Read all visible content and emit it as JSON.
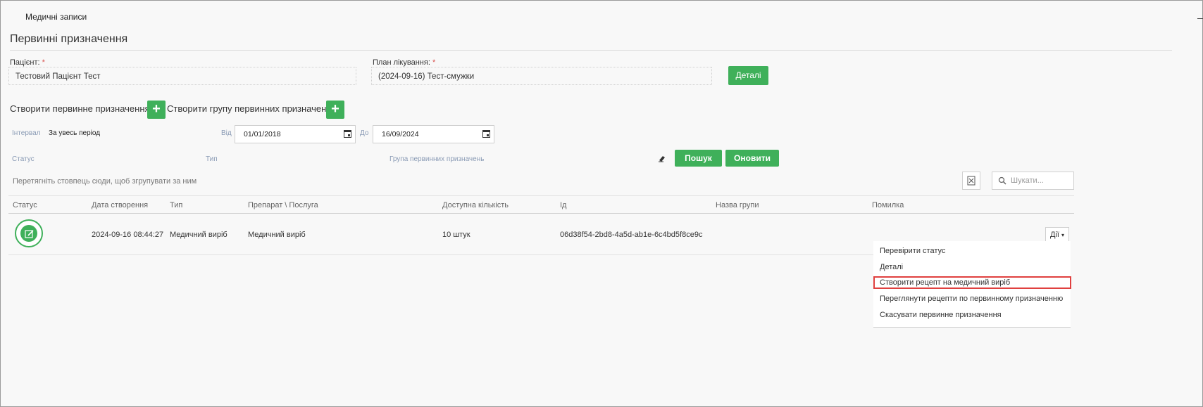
{
  "breadcrumb": "Медичні записи",
  "page_title": "Первинні призначення",
  "patient": {
    "label": "Пацієнт:",
    "required_mark": "*",
    "value": "Тестовий Пацієнт Тест"
  },
  "plan": {
    "label": "План лікування:",
    "required_mark": "*",
    "value": "(2024-09-16) Тест-смужки"
  },
  "details_button": "Деталі",
  "create": {
    "primary_label": "Створити первинне призначення",
    "group_label": "Створити групу первинних призначень",
    "plus_glyph": "+"
  },
  "filters": {
    "interval_label": "Інтервал",
    "interval_value": "За увесь період",
    "from_label": "Від",
    "from_value": "01/01/2018",
    "to_label": "До",
    "to_value": "16/09/2024",
    "status_label": "Статус",
    "type_label": "Тип",
    "group_label": "Група первинних призначень"
  },
  "buttons": {
    "search": "Пошук",
    "refresh": "Оновити"
  },
  "grid": {
    "group_hint": "Перетягніть стовпець сюди, щоб згрупувати за ним",
    "search_placeholder": "Шукати...",
    "columns": [
      "Статус",
      "Дата створення",
      "Тип",
      "Препарат \\ Послуга",
      "Доступна кількість",
      "Ід",
      "Назва групи",
      "Помилка"
    ],
    "rows": [
      {
        "date": "2024-09-16 08:44:27",
        "type": "Медичний виріб",
        "item": "Медичний виріб",
        "quantity": "10 штук",
        "id": "06d38f54-2bd8-4a5d-ab1e-6c4bd5f8ce9c",
        "group": "",
        "error": ""
      }
    ],
    "actions_label": "Дії"
  },
  "action_menu": {
    "items": [
      "Перевірити статус",
      "Деталі",
      "Створити рецепт на медичний виріб",
      "Переглянути рецепти по первинному призначенню",
      "Скасувати первинне призначення"
    ],
    "highlighted_index": 2
  },
  "colors": {
    "accent": "#3fb05a",
    "highlight": "#e0403f"
  }
}
